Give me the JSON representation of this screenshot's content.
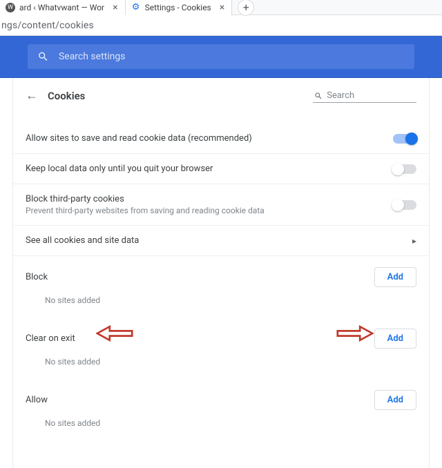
{
  "tabs": [
    {
      "title": "ard ‹ Whatvwant — Wor",
      "icon": "w"
    },
    {
      "title": "Settings - Cookies",
      "icon": "gear"
    }
  ],
  "address_bar": "ngs/content/cookies",
  "search_placeholder": "Search settings",
  "header": {
    "title": "Cookies",
    "search_placeholder": "Search"
  },
  "rows": {
    "allow_save": {
      "label": "Allow sites to save and read cookie data (recommended)",
      "on": true
    },
    "keep_local": {
      "label": "Keep local data only until you quit your browser",
      "on": false
    },
    "block_third": {
      "label": "Block third-party cookies",
      "sub": "Prevent third-party websites from saving and reading cookie data",
      "on": false
    },
    "see_all": {
      "label": "See all cookies and site data"
    }
  },
  "sections": {
    "block": {
      "title": "Block",
      "add": "Add",
      "empty": "No sites added"
    },
    "clear_on_exit": {
      "title": "Clear on exit",
      "add": "Add",
      "empty": "No sites added"
    },
    "allow": {
      "title": "Allow",
      "add": "Add",
      "empty": "No sites added"
    }
  }
}
